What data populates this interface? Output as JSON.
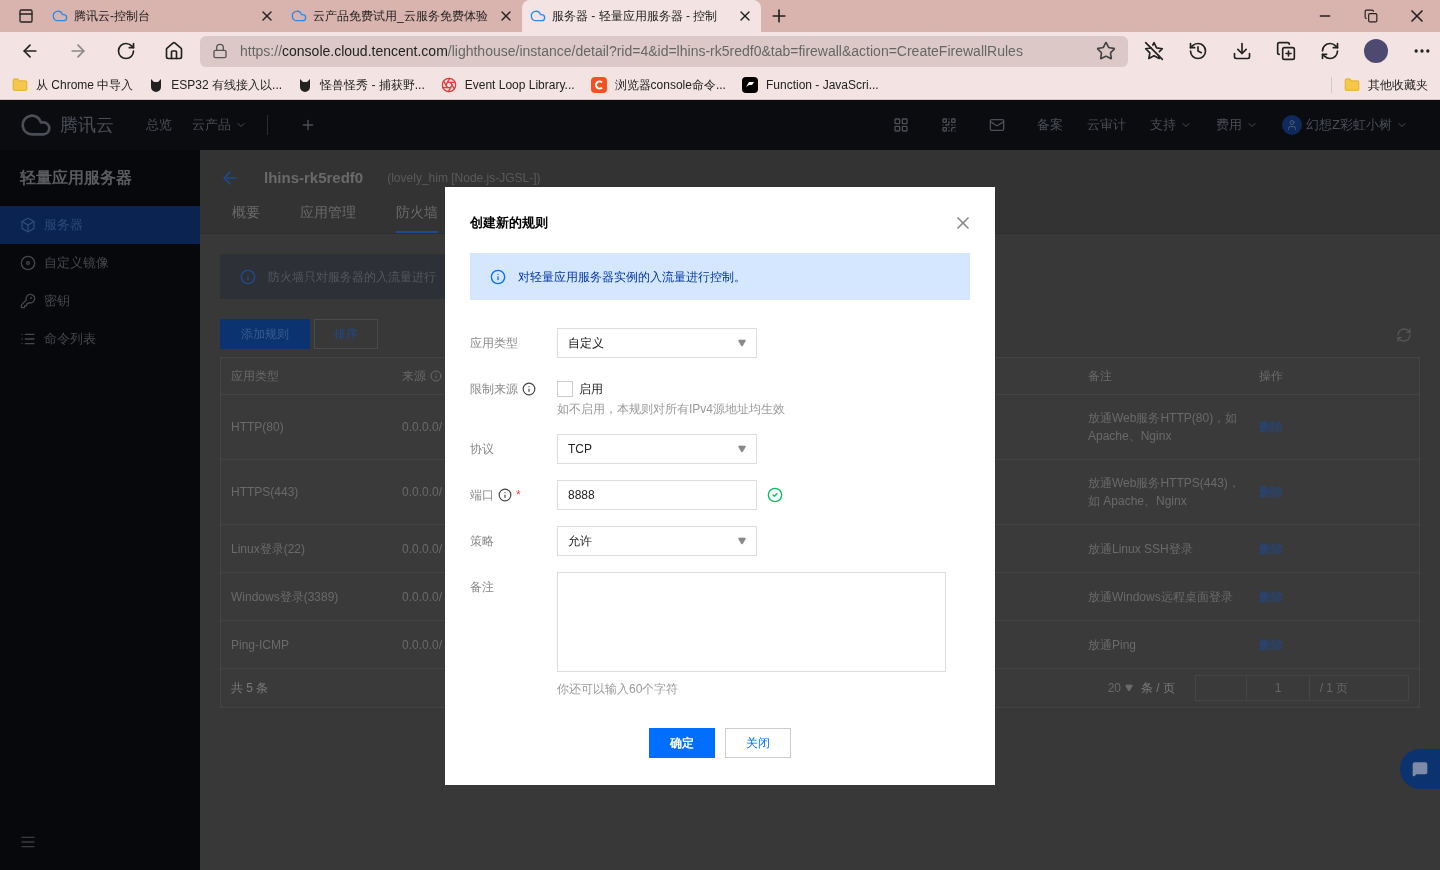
{
  "browser": {
    "tabs": [
      {
        "title": "腾讯云-控制台",
        "selected": false
      },
      {
        "title": "云产品免费试用_云服务免费体验",
        "selected": false
      },
      {
        "title": "服务器 - 轻量应用服务器 - 控制",
        "selected": true
      }
    ],
    "url": {
      "scheme": "https://",
      "host": "console.cloud.tencent.com",
      "path": "/lighthouse/instance/detail?rid=4&id=lhins-rk5redf0&tab=firewall&action=CreateFirewallRules"
    },
    "bookmarks": [
      {
        "label": "从 Chrome 中导入",
        "kind": "folder"
      },
      {
        "label": "ESP32 有线接入以...",
        "kind": "cat"
      },
      {
        "label": "怪兽怪秀 - 捕获野...",
        "kind": "cat"
      },
      {
        "label": "Event Loop Library...",
        "kind": "spiral"
      },
      {
        "label": "浏览器console命令...",
        "kind": "c"
      },
      {
        "label": "Function - JavaScri...",
        "kind": "dark"
      }
    ],
    "other_bookmarks": "其他收藏夹"
  },
  "topnav": {
    "brand": "腾讯云",
    "items": [
      {
        "label": "总览",
        "dropdown": false
      },
      {
        "label": "云产品",
        "dropdown": true
      }
    ],
    "right": [
      {
        "label": "备案",
        "dropdown": false
      },
      {
        "label": "云审计",
        "dropdown": false
      },
      {
        "label": "支持",
        "dropdown": true
      },
      {
        "label": "费用",
        "dropdown": true
      }
    ],
    "user": "幻想Z彩虹小树"
  },
  "sidebar": {
    "title": "轻量应用服务器",
    "items": [
      {
        "label": "服务器",
        "kind": "box",
        "selected": true
      },
      {
        "label": "自定义镜像",
        "kind": "disc",
        "selected": false
      },
      {
        "label": "密钥",
        "kind": "key",
        "selected": false
      },
      {
        "label": "命令列表",
        "kind": "list",
        "selected": false
      }
    ]
  },
  "instance": {
    "id": "lhins-rk5redf0",
    "name": "(lovely_him [Node.js-JGSL-])",
    "tabs": [
      {
        "label": "概要",
        "selected": false
      },
      {
        "label": "应用管理",
        "selected": false
      },
      {
        "label": "防火墙",
        "selected": true
      }
    ],
    "notice": "防火墙只对服务器的入流量进行",
    "buttons": [
      "添加规则",
      "排序"
    ],
    "columns": [
      "应用类型",
      "来源",
      "备注",
      "操作"
    ],
    "rows": [
      {
        "type": "HTTP(80)",
        "source": "0.0.0.0/",
        "remark": "放通Web服务HTTP(80)，如Apache、Nginx",
        "action": "删除"
      },
      {
        "type": "HTTPS(443)",
        "source": "0.0.0.0/",
        "remark": "放通Web服务HTTPS(443)，如 Apache、Nginx",
        "action": "删除"
      },
      {
        "type": "Linux登录(22)",
        "source": "0.0.0.0/",
        "remark": "放通Linux SSH登录",
        "action": "删除"
      },
      {
        "type": "Windows登录(3389)",
        "source": "0.0.0.0/",
        "remark": "放通Windows远程桌面登录",
        "action": "删除"
      },
      {
        "type": "Ping-ICMP",
        "source": "0.0.0.0/",
        "remark": "放通Ping",
        "action": "删除"
      }
    ],
    "total": "共 5 条",
    "page_size": "20",
    "per_page": "条 / 页",
    "page": "1",
    "pages": "/ 1 页"
  },
  "modal": {
    "title": "创建新的规则",
    "info": "对轻量应用服务器实例的入流量进行控制。",
    "fields": [
      {
        "kind": "select",
        "label": "应用类型",
        "value": "自定义",
        "info": false,
        "required": false
      },
      {
        "kind": "checkbox",
        "label": "限制来源",
        "value": "启用",
        "checked": false,
        "hint": "如不启用，本规则对所有IPv4源地址均生效",
        "info": true,
        "required": false
      },
      {
        "kind": "select",
        "label": "协议",
        "value": "TCP",
        "info": false,
        "required": false
      },
      {
        "kind": "input",
        "label": "端口",
        "value": "8888",
        "info": true,
        "required": true,
        "valid": true
      },
      {
        "kind": "select",
        "label": "策略",
        "value": "允许",
        "info": false,
        "required": false
      },
      {
        "kind": "textarea",
        "label": "备注",
        "hint": "你还可以输入60个字符",
        "info": false,
        "required": false
      }
    ],
    "required_mark": "*",
    "buttons": [
      {
        "label": "确定",
        "primary": true
      },
      {
        "label": "关闭",
        "primary": false
      }
    ]
  }
}
